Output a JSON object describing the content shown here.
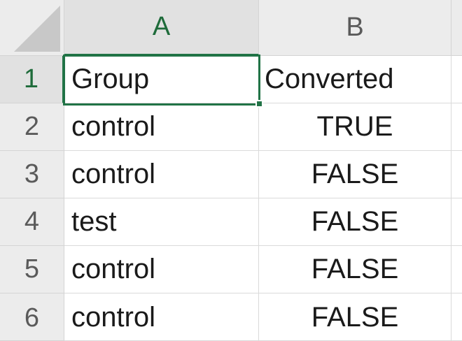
{
  "sheet": {
    "columns": [
      "A",
      "B"
    ],
    "active_column": "A",
    "active_row": "1",
    "active_cell": "A1",
    "rows": [
      {
        "num": "1",
        "a": "Group",
        "b": "Converted"
      },
      {
        "num": "2",
        "a": "control",
        "b": "TRUE"
      },
      {
        "num": "3",
        "a": "control",
        "b": "FALSE"
      },
      {
        "num": "4",
        "a": "test",
        "b": "FALSE"
      },
      {
        "num": "5",
        "a": "control",
        "b": "FALSE"
      },
      {
        "num": "6",
        "a": "control",
        "b": "FALSE"
      }
    ]
  },
  "colors": {
    "selection": "#217346",
    "header_bg": "#ececec",
    "header_active_text": "#1e6b3a"
  }
}
